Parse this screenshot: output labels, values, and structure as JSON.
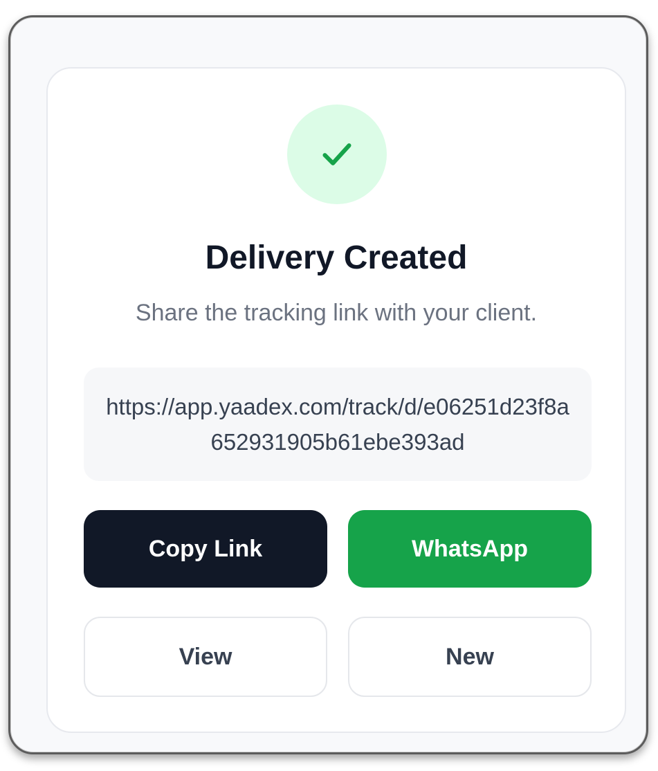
{
  "dialog": {
    "title": "Delivery Created",
    "subtitle": "Share the tracking link with your client.",
    "tracking_link": "https://app.yaadex.com/track/d/e06251d23f8a652931905b61ebe393ad",
    "success_icon": "check-icon"
  },
  "actions": {
    "copy_label": "Copy Link",
    "whatsapp_label": "WhatsApp",
    "view_label": "View",
    "new_label": "New"
  },
  "colors": {
    "primary_dark": "#111827",
    "success_green": "#16a34a",
    "success_tint": "#dcfce7",
    "muted_text": "#6b7280"
  }
}
